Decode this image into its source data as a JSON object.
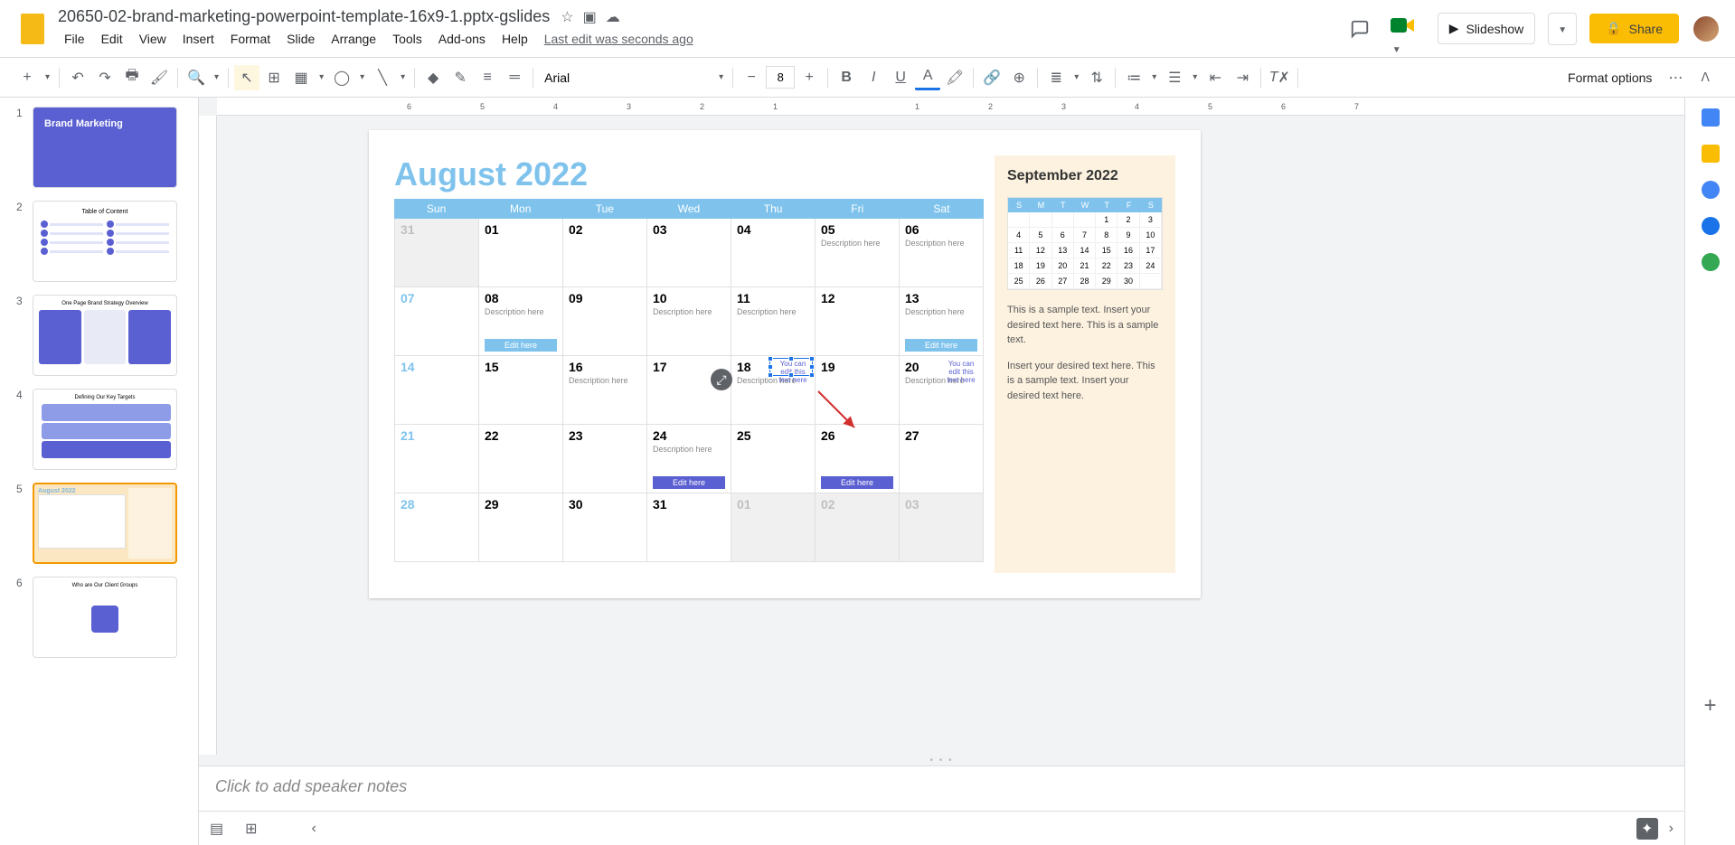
{
  "docTitle": "20650-02-brand-marketing-powerpoint-template-16x9-1.pptx-gslides",
  "menuBar": [
    "File",
    "Edit",
    "View",
    "Insert",
    "Format",
    "Slide",
    "Arrange",
    "Tools",
    "Add-ons",
    "Help"
  ],
  "lastEdit": "Last edit was seconds ago",
  "slideshowLabel": "Slideshow",
  "shareLabel": "Share",
  "toolbar": {
    "font": "Arial",
    "size": "8",
    "formatOptions": "Format options"
  },
  "thumbs": [
    {
      "num": "1",
      "title": "Brand Marketing"
    },
    {
      "num": "2",
      "title": "Table of Content"
    },
    {
      "num": "3",
      "title": "One Page Brand Strategy Overview"
    },
    {
      "num": "4",
      "title": "Defining Our Key Targets"
    },
    {
      "num": "5",
      "title": "August 2022"
    },
    {
      "num": "6",
      "title": "Who are Our Client Groups"
    }
  ],
  "slide": {
    "monthTitle": "August 2022",
    "weekdays": [
      "Sun",
      "Mon",
      "Tue",
      "Wed",
      "Thu",
      "Fri",
      "Sat"
    ],
    "cells": [
      {
        "d": "31",
        "dim": true
      },
      {
        "d": "01"
      },
      {
        "d": "02"
      },
      {
        "d": "03"
      },
      {
        "d": "04"
      },
      {
        "d": "05",
        "desc": "Description here"
      },
      {
        "d": "06",
        "desc": "Description here"
      },
      {
        "d": "07",
        "sun": true
      },
      {
        "d": "08",
        "desc": "Description here",
        "pill": "Edit here",
        "pillLight": true
      },
      {
        "d": "09"
      },
      {
        "d": "10",
        "desc": "Description here"
      },
      {
        "d": "11",
        "desc": "Description here"
      },
      {
        "d": "12"
      },
      {
        "d": "13",
        "desc": "Description here",
        "pill": "Edit here",
        "pillLight": true
      },
      {
        "d": "14",
        "sun": true
      },
      {
        "d": "15"
      },
      {
        "d": "16",
        "desc": "Description here"
      },
      {
        "d": "17"
      },
      {
        "d": "18",
        "desc": "Description here",
        "note": "You can edit this text here",
        "selected": true
      },
      {
        "d": "19"
      },
      {
        "d": "20",
        "desc": "Description here",
        "note": "You can edit this text here"
      },
      {
        "d": "21",
        "sun": true
      },
      {
        "d": "22"
      },
      {
        "d": "23"
      },
      {
        "d": "24",
        "desc": "Description here",
        "pill": "Edit here"
      },
      {
        "d": "25"
      },
      {
        "d": "26",
        "pill": "Edit here"
      },
      {
        "d": "27"
      },
      {
        "d": "28",
        "sun": true
      },
      {
        "d": "29"
      },
      {
        "d": "30"
      },
      {
        "d": "31"
      },
      {
        "d": "01",
        "dim": true
      },
      {
        "d": "02",
        "dim": true
      },
      {
        "d": "03",
        "dim": true
      }
    ],
    "miniTitle": "September 2022",
    "miniWeekdays": [
      "S",
      "M",
      "T",
      "W",
      "T",
      "F",
      "S"
    ],
    "miniGrid": [
      "",
      "",
      "",
      "",
      "1",
      "2",
      "3",
      "4",
      "5",
      "6",
      "7",
      "8",
      "9",
      "10",
      "11",
      "12",
      "13",
      "14",
      "15",
      "16",
      "17",
      "18",
      "19",
      "20",
      "21",
      "22",
      "23",
      "24",
      "25",
      "26",
      "27",
      "28",
      "29",
      "30",
      ""
    ],
    "text1": "This is a sample text. Insert your desired text here. This is a sample text.",
    "text2": "Insert your desired text here. This is a sample text. Insert your desired text here."
  },
  "speakerNotes": "Click to add speaker notes",
  "rulerMarks": [
    "6",
    "5",
    "4",
    "3",
    "2",
    "1",
    "1",
    "2",
    "3",
    "4",
    "5",
    "6",
    "7"
  ]
}
